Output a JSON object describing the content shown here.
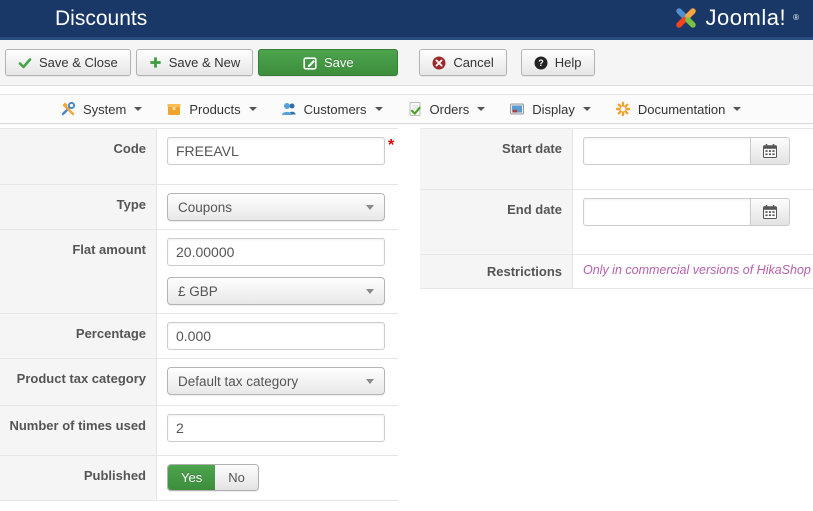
{
  "header": {
    "title": "Discounts",
    "logo_text": "Joomla!",
    "logo_mark": "®"
  },
  "toolbar": {
    "save_close": "Save & Close",
    "save_new": "Save & New",
    "save": "Save",
    "cancel": "Cancel",
    "help": "Help"
  },
  "menubar": {
    "items": [
      {
        "label": "System",
        "icon": "tools-icon"
      },
      {
        "label": "Products",
        "icon": "box-icon"
      },
      {
        "label": "Customers",
        "icon": "users-icon"
      },
      {
        "label": "Orders",
        "icon": "order-check-icon"
      },
      {
        "label": "Display",
        "icon": "monitor-icon"
      },
      {
        "label": "Documentation",
        "icon": "asterisk-icon"
      }
    ]
  },
  "form": {
    "left": {
      "code": {
        "label": "Code",
        "value": "FREEAVL",
        "required_mark": "*"
      },
      "type": {
        "label": "Type",
        "value": "Coupons"
      },
      "flat_amount": {
        "label": "Flat amount",
        "value": "20.00000",
        "currency": "£ GBP"
      },
      "percentage": {
        "label": "Percentage",
        "value": "0.000"
      },
      "tax_category": {
        "label": "Product tax category",
        "value": "Default tax category"
      },
      "times_used": {
        "label": "Number of times used",
        "value": "2"
      },
      "published": {
        "label": "Published",
        "yes": "Yes",
        "no": "No"
      }
    },
    "right": {
      "start_date": {
        "label": "Start date",
        "value": ""
      },
      "end_date": {
        "label": "End date",
        "value": ""
      },
      "restrictions": {
        "label": "Restrictions",
        "note": "Only in commercial versions of HikaShop"
      }
    }
  },
  "colors": {
    "header_bg": "#1a3867",
    "accent_green": "#46a546",
    "cancel_red": "#9d2a2a",
    "link_pink": "#b55fae",
    "label_bg": "#f5f5f5",
    "border": "#e6e6e6"
  }
}
